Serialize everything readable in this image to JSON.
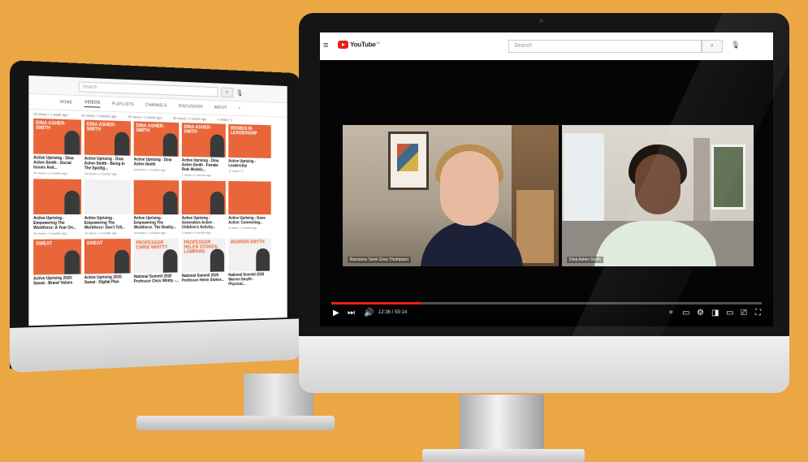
{
  "colors": {
    "background": "#eba743",
    "brand_orange": "#e8663a",
    "youtube_red": "#e62117"
  },
  "back_monitor": {
    "search_placeholder": "Search",
    "tabs": [
      "HOME",
      "VIDEOS",
      "PLAYLISTS",
      "CHANNELS",
      "DISCUSSION",
      "ABOUT"
    ],
    "active_tab": "VIDEOS",
    "meta_row": [
      "23 views • 1 week ago",
      "44 views • 3 weeks ago",
      "40 views • 1 month ago",
      "90 views • 1 month ago",
      "4 views • 2"
    ],
    "rows": [
      [
        {
          "thumb": "DINA ASHER-SMITH",
          "title": "Active Uprising - Dina Asher-Smith - Social Issues And...",
          "meta": "41 views • 2 months ago"
        },
        {
          "thumb": "DINA ASHER-SMITH",
          "title": "Active Uprising - Dina Asher-Smith - Being In The Spotlig...",
          "meta": "24 views • 2 months ago"
        },
        {
          "thumb": "DINA ASHER-SMITH",
          "title": "Active Uprising - Dina Asher-Smith",
          "meta": "28 views • 2 months ago"
        },
        {
          "thumb": "DINA ASHER-SMITH",
          "title": "Active Uprising - Dina Asher-Smith - Female Role Models...",
          "meta": "7 views • 2 months ago"
        },
        {
          "thumb": "WOMEN IN LEADERSHIP",
          "title": "Active Uprising - Leadership",
          "meta": "11 views • 2"
        }
      ],
      [
        {
          "thumb": "",
          "title": "Active Uprising - Empowering The Workforce: A Year On...",
          "meta": "24 views • 2 months ago"
        },
        {
          "thumb": "",
          "title": "Active Uprising - Empowering The Workforce: Don't Tell...",
          "meta": "10 views • 2 months ago"
        },
        {
          "thumb": "",
          "title": "Active Uprising - Empowering The Workforce: The Reality...",
          "meta": "16 views • 2 months ago"
        },
        {
          "thumb": "",
          "title": "Active Uprising - Generation Active - Children's Activity...",
          "meta": "4 views • 2 months ago"
        },
        {
          "thumb": "",
          "title": "Active Uprising - Gene Active: Connecting...",
          "meta": "8 views • 2 months ago"
        }
      ],
      [
        {
          "thumb": "SWEAT",
          "title": "Active Uprising 2020: Sweat - Brand Values",
          "meta": ""
        },
        {
          "thumb": "SWEAT",
          "title": "Active Uprising 2020: Sweat - Digital Plan",
          "meta": ""
        },
        {
          "thumb": "PROFESSOR CHRIS WHITTY",
          "title": "National Summit 2020 Professor Chris Whitty -...",
          "meta": ""
        },
        {
          "thumb": "PROFESSOR HELEN STOKES-LAMPARD",
          "title": "National Summit 2020 Professor Helen Stokes...",
          "meta": ""
        },
        {
          "thumb": "WARREN SMYTH",
          "title": "National Summit 2020 Warren Smyth - Physical...",
          "meta": ""
        }
      ]
    ]
  },
  "front_monitor": {
    "logo_text": "YouTube",
    "logo_region": "GB",
    "search_placeholder": "Search",
    "participants": {
      "left_name": "Baroness Tanni Grey-Thompson",
      "right_name": "Dina Asher-Smith"
    },
    "player": {
      "time_display": "12:36 / 59:14",
      "progress": 0.21
    }
  }
}
